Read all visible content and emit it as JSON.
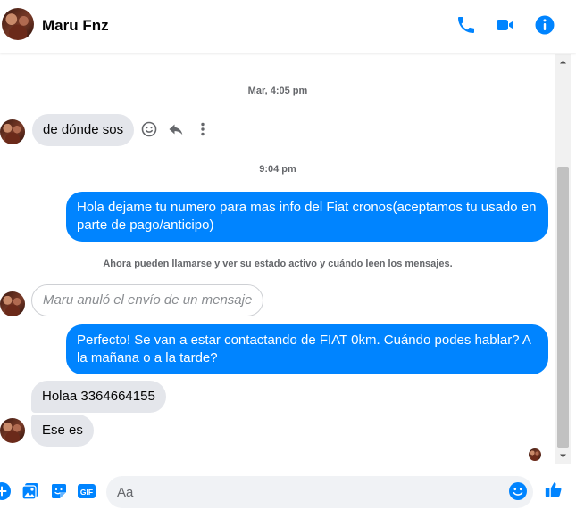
{
  "header": {
    "contact_name": "Maru Fnz",
    "icons": [
      "phone-icon",
      "video-camera-icon",
      "info-icon"
    ]
  },
  "colors": {
    "accent": "#0084ff",
    "incoming_bubble": "#e4e6eb",
    "meta_text": "#65676b"
  },
  "thread": {
    "timestamp_1": "Mar, 4:05 pm",
    "msg_1": "de dónde sos",
    "timestamp_2": "9:04 pm",
    "msg_2": "Hola dejame tu numero para mas info del Fiat cronos(aceptamos tu usado en parte de pago/anticipo)",
    "notice": "Ahora pueden llamarse y ver su estado activo y cuándo leen los mensajes.",
    "unsent": "Maru anuló el envío de un mensaje",
    "msg_3": "Perfecto!  Se van a estar contactando de FIAT 0km. Cuándo podes hablar? A la mañana o a la tarde?",
    "msg_4": "Holaa 3364664155",
    "msg_5": "Ese es",
    "message_actions": [
      "smiley-react-icon",
      "reply-icon",
      "more-options-icon"
    ]
  },
  "composer": {
    "placeholder": "Aa",
    "icons": [
      "plus-icon",
      "photo-icon",
      "sticker-icon",
      "gif-icon",
      "emoji-icon",
      "thumbs-up-icon"
    ],
    "gif_label": "GIF"
  }
}
